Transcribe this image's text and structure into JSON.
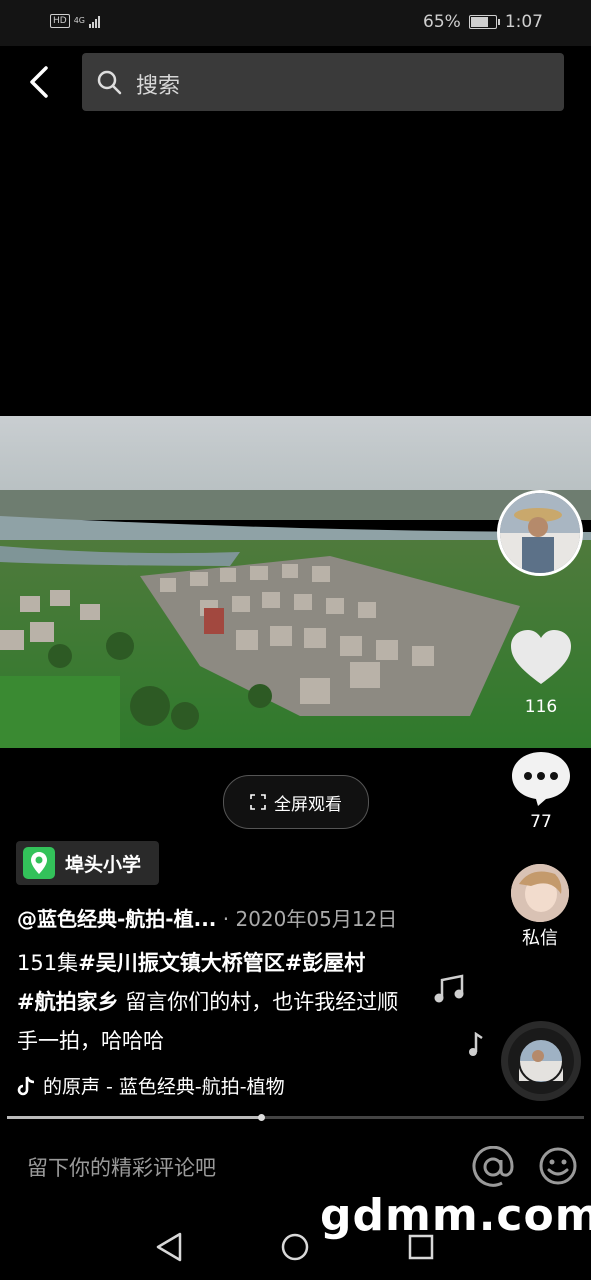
{
  "status_bar": {
    "network_hd": "HD",
    "network_gen": "4G",
    "battery": "65%",
    "time": "1:07",
    "battery_level": 0.65
  },
  "search": {
    "placeholder": "搜索"
  },
  "video": {
    "fullscreen_label": "全屏观看"
  },
  "actions": {
    "like_count": "116",
    "comment_count": "77",
    "dm_label": "私信"
  },
  "post": {
    "location": "埠头小学",
    "author": "@蓝色经典-航拍-植...",
    "date": " · 2020年05月12日",
    "description": {
      "count": "151集",
      "tag1": "#吴川振文镇大桥管区",
      "tag2": "#彭屋村",
      "tag3": "#航拍家乡",
      "text": " 留言你们的村，也许我经过顺手一拍，哈哈哈"
    },
    "music": "的原声 - 蓝色经典-航拍-植物"
  },
  "playback": {
    "progress": 0.44
  },
  "comment_bar": {
    "placeholder": "留下你的精彩评论吧"
  },
  "watermark": "gdmm.com",
  "icons": [
    "back-arrow-icon",
    "search-icon",
    "heart-icon",
    "comment-icon",
    "fullscreen-icon",
    "location-pin-icon",
    "music-note-icon",
    "tiktok-icon",
    "at-icon",
    "emoji-icon",
    "nav-back-icon",
    "nav-home-icon",
    "nav-recent-icon"
  ]
}
